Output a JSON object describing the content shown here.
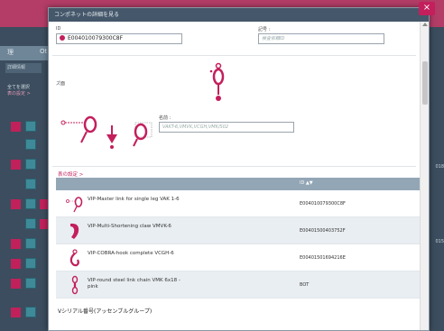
{
  "background": {
    "tabs": [
      "理",
      "Ot"
    ],
    "subtab": "詳細情報",
    "select_all": "全てを選択",
    "pink_link": "表の設定 >",
    "right_values": [
      "018",
      "015"
    ]
  },
  "modal": {
    "title": "コンポネットの詳細を見る",
    "close_symbol": "×",
    "id_label": "ID",
    "id_value": "E004010079300C8F",
    "number_label": "記号 :",
    "number_placeholder": "検査依頼ID",
    "image_label": "ズ面",
    "name_label": "名前 :",
    "name_value": "VAKT-6,VMVK,VCGH,VMK/S02",
    "table_settings_link": "表の設定 >",
    "table": {
      "column_header": "ID ▲▼",
      "rows": [
        {
          "desc": "VIP-Master link for single leg VAK 1-6",
          "code": "E004010079300C8F",
          "icon": "master-link-icon"
        },
        {
          "desc": "VIP-Multi-Shortening claw VMVK-6",
          "code": "E00401500403752F",
          "icon": "shortening-claw-icon"
        },
        {
          "desc": "VIP-COBRA-hook complete VCGH-6",
          "code": "E00401501694216E",
          "icon": "cobra-hook-icon"
        },
        {
          "desc": "VIP-round steel link chain VMK 6x18 - pink",
          "code": "BOT",
          "icon": "chain-icon"
        }
      ]
    },
    "footer_label": "Vシリアル番号(アッセンブルグループ)"
  },
  "colors": {
    "accent": "#c31f5c",
    "header": "#45576a",
    "table_header": "#93a6b6"
  }
}
